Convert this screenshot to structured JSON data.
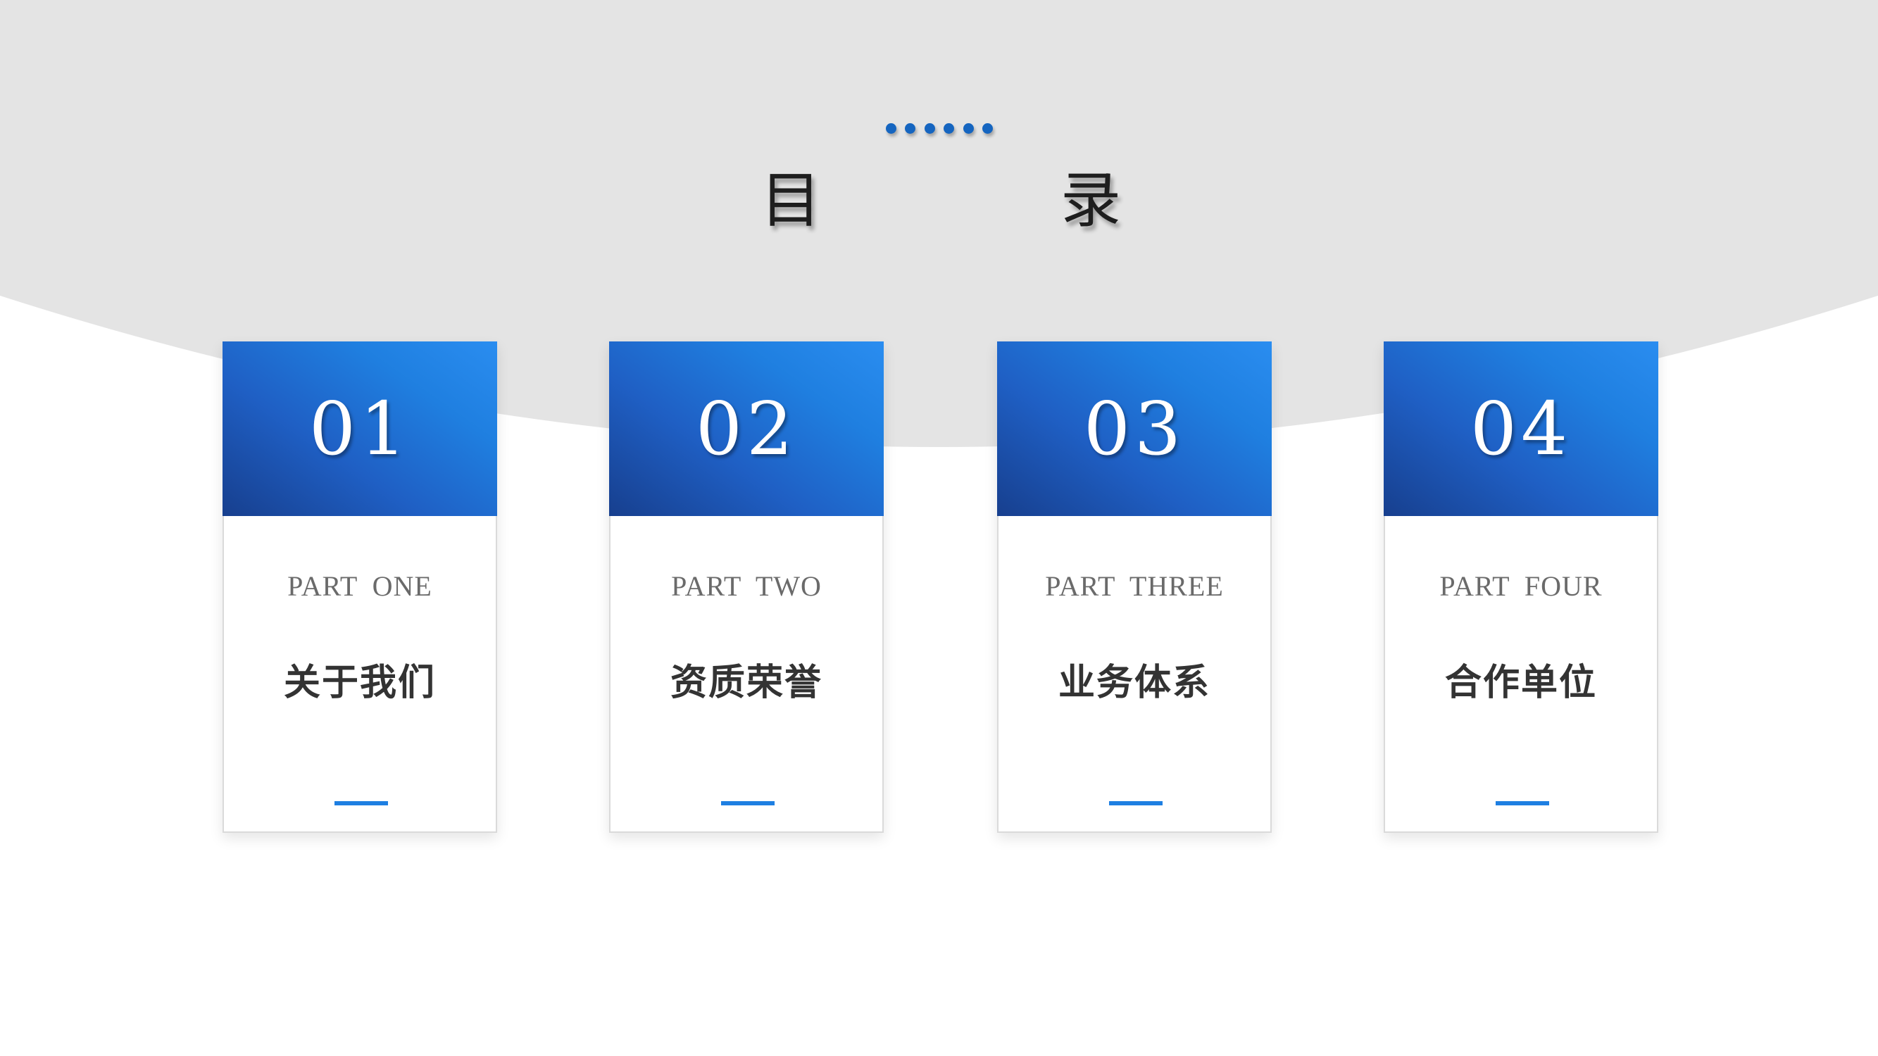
{
  "title": {
    "left_char": "目",
    "right_char": "录"
  },
  "colors": {
    "accent": "#1e7fe2",
    "dots": "#1565c0",
    "arc_background": "#e4e4e4"
  },
  "cards": [
    {
      "number": "01",
      "part": "PART ONE",
      "label": "关于我们"
    },
    {
      "number": "02",
      "part": "PART TWO",
      "label": "资质荣誉"
    },
    {
      "number": "03",
      "part": "PART THREE",
      "label": "业务体系"
    },
    {
      "number": "04",
      "part": "PART FOUR",
      "label": "合作单位"
    }
  ]
}
